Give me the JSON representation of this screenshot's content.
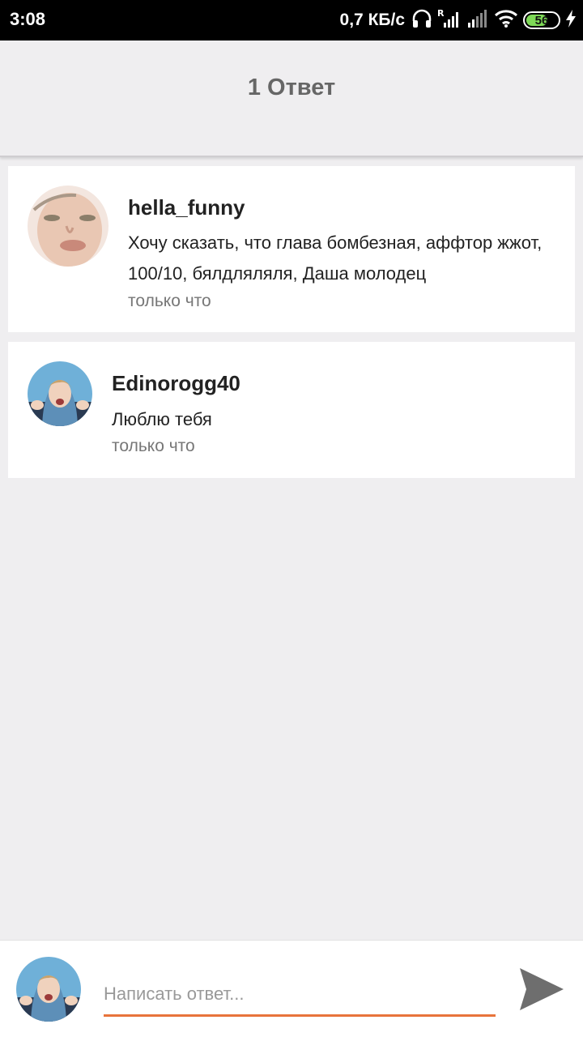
{
  "status_bar": {
    "time": "3:08",
    "net_speed": "0,7 КБ/с",
    "battery": "56",
    "icons": [
      "headphones-icon",
      "signal-roaming-icon",
      "signal-icon",
      "wifi-icon",
      "battery-icon",
      "charging-icon"
    ]
  },
  "header": {
    "title": "1 Ответ"
  },
  "comments": [
    {
      "username": "hella_funny",
      "text": "Хочу сказать, что глава бомбезная, аффтор жжот, 100/10, бялдляляля, Даша молодец",
      "time": "только что"
    },
    {
      "username": "Edinorogg40",
      "text": "Люблю тебя",
      "time": "только что"
    }
  ],
  "compose": {
    "placeholder": "Написать ответ...",
    "accent_color": "#e8743b",
    "send_icon": "send-icon"
  }
}
